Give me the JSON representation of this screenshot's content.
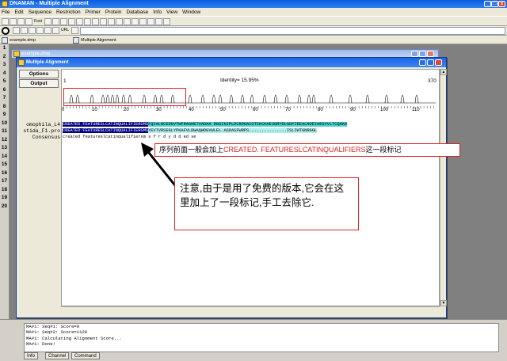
{
  "app": {
    "title": "DNAMAN - Multiple Alignment",
    "window_controls": [
      "_",
      "□",
      "x"
    ]
  },
  "menu": [
    "File",
    "Edit",
    "Sequence",
    "Restriction",
    "Primer",
    "Protein",
    "Database",
    "Info",
    "View",
    "Window"
  ],
  "toolbar": {
    "font_label": "Font",
    "url_label": "URL"
  },
  "doc_tabs": [
    "example.dmp",
    "Multiple Alignment"
  ],
  "gutter_rows": [
    "1",
    "2",
    "3",
    "4",
    "5",
    "6",
    "7",
    "8",
    "9",
    "10",
    "11",
    "12",
    "13",
    "14",
    "15",
    "16",
    "17",
    "18",
    "19",
    "20"
  ],
  "mdi_window": {
    "title": "example.dmp"
  },
  "alignment_window": {
    "title": "Multiple Alignment",
    "options_label": "Options",
    "output_label": "Output",
    "identity": "Identity= 15.95%",
    "ruler_start": "1",
    "ruler_end": "370",
    "ruler_ticks": [
      "0",
      "10",
      "20",
      "30",
      "40",
      "50",
      "60",
      "70",
      "80",
      "90",
      "100",
      "110"
    ],
    "sequences": [
      {
        "name": "omophila_L4",
        "seg1": "CREATED FEATURESLCATINQUALIFIERSMS",
        "seg2": "FQIALNCEDGVTWFRAGHETVADAA RGGINIPLDCRDGACGTCKCKAESGRYDLGDFIEEALNDEIAEGYVLTCQAKA"
      },
      {
        "name": "stida_F1.pro",
        "seg1": "CREATED FEATURESLCATINQUALIFIERSMS",
        "seg2": "YEVTVRSEGLYPKAFVLDWAQWDGVWLEL.ASDASFWRPS...............ISLIWTGNRGGL"
      },
      {
        "name": "Consensus",
        "seg1": "created featureslcatinqualifiersm",
        "seg2": "s     f    r d    y                       d d  ed  se"
      }
    ]
  },
  "annotations": {
    "note1_prefix": "序列前面一般会加上",
    "note1_highlight": "CREATED. FEATURESLCATINQUALIFIERS",
    "note1_suffix": "这一段标记",
    "note2": "注意,由于是用了免费的版本,它会在这里加上了一段标记,手工去除它."
  },
  "output_panel": {
    "lines": [
      "MA#1: Seq#1: Score=0",
      "MA#1: Seq#2: Score=1120",
      "MA#1: Calculating Alignment Score...",
      "MA#1: Done!"
    ],
    "tabs": [
      "Info",
      "Channel",
      "Command"
    ]
  },
  "colors": {
    "title_blue": "#1c64e6",
    "highlight_navy": "#000080",
    "highlight_teal": "#48d1cc",
    "annotation_red": "#dd2222"
  }
}
